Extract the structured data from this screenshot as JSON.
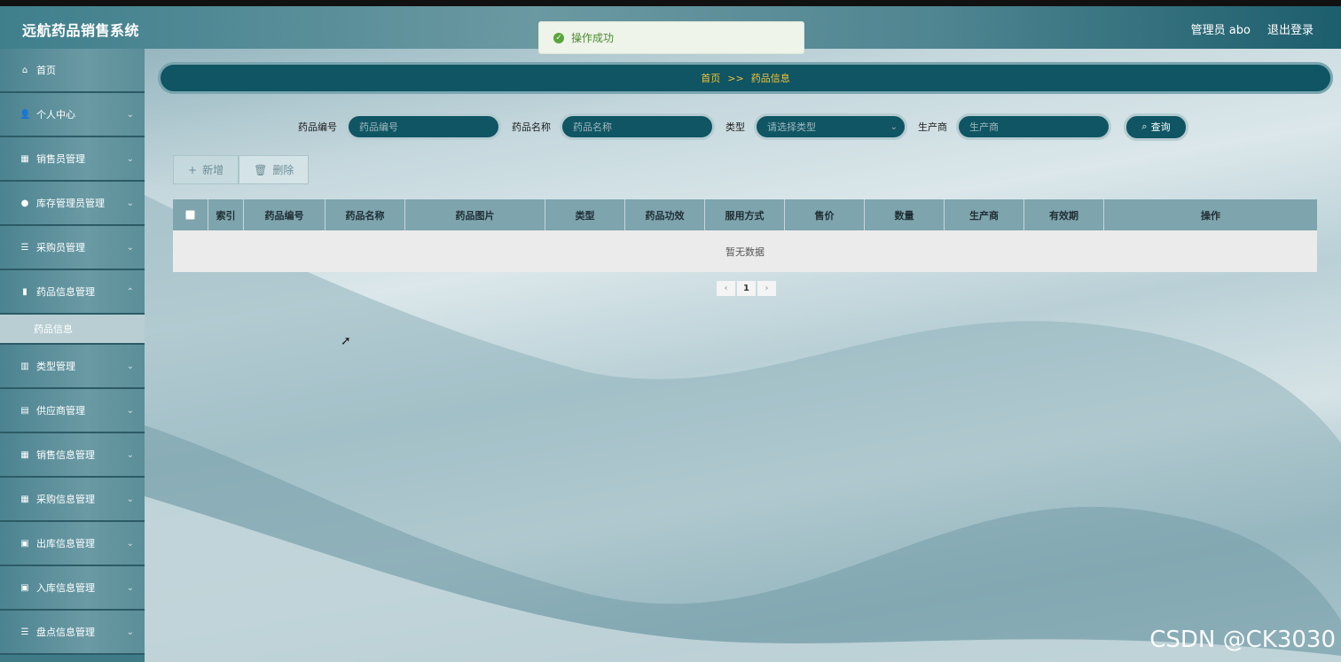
{
  "app": {
    "title": "远航药品销售系统"
  },
  "header": {
    "user_label": "管理员 abo",
    "logout_label": "退出登录"
  },
  "toast": {
    "message": "操作成功"
  },
  "sidebar": {
    "items": [
      {
        "label": "首页",
        "icon": "home-icon",
        "glyph": "⌂",
        "expandable": false
      },
      {
        "label": "个人中心",
        "icon": "user-icon",
        "glyph": "👤",
        "expandable": true
      },
      {
        "label": "销售员管理",
        "icon": "grid-icon",
        "glyph": "▦",
        "expandable": true
      },
      {
        "label": "库存管理员管理",
        "icon": "pin-icon",
        "glyph": "●",
        "expandable": true
      },
      {
        "label": "采购员管理",
        "icon": "list-icon",
        "glyph": "☰",
        "expandable": true
      },
      {
        "label": "药品信息管理",
        "icon": "thumb-icon",
        "glyph": "▮",
        "expandable": true
      },
      {
        "label": "类型管理",
        "icon": "bar-chart-icon",
        "glyph": "▥",
        "expandable": true
      },
      {
        "label": "供应商管理",
        "icon": "briefcase-icon",
        "glyph": "▤",
        "expandable": true
      },
      {
        "label": "销售信息管理",
        "icon": "grid-icon",
        "glyph": "▦",
        "expandable": true
      },
      {
        "label": "采购信息管理",
        "icon": "grid-icon",
        "glyph": "▦",
        "expandable": true
      },
      {
        "label": "出库信息管理",
        "icon": "clipboard-icon",
        "glyph": "▣",
        "expandable": true
      },
      {
        "label": "入库信息管理",
        "icon": "clipboard-icon",
        "glyph": "▣",
        "expandable": true
      },
      {
        "label": "盘点信息管理",
        "icon": "list-icon",
        "glyph": "☰",
        "expandable": true
      }
    ],
    "active_sub": "药品信息"
  },
  "breadcrumb": {
    "home": "首页",
    "separator": ">>",
    "current": "药品信息"
  },
  "search": {
    "code_label": "药品编号",
    "code_placeholder": "药品编号",
    "name_label": "药品名称",
    "name_placeholder": "药品名称",
    "type_label": "类型",
    "type_placeholder": "请选择类型",
    "maker_label": "生产商",
    "maker_placeholder": "生产商",
    "query_label": "查询"
  },
  "actions": {
    "add_label": "新增",
    "delete_label": "删除"
  },
  "table": {
    "columns": [
      "索引",
      "药品编号",
      "药品名称",
      "药品图片",
      "类型",
      "药品功效",
      "服用方式",
      "售价",
      "数量",
      "生产商",
      "有效期",
      "操作"
    ],
    "empty_text": "暂无数据"
  },
  "pagination": {
    "current_page": "1",
    "prev": "‹",
    "next": "›"
  },
  "watermark": "CSDN @CK3030",
  "colors": {
    "accent": "#0f5563",
    "breadcrumb_text": "#f3c33a",
    "toast_text": "#4e8a2f"
  }
}
